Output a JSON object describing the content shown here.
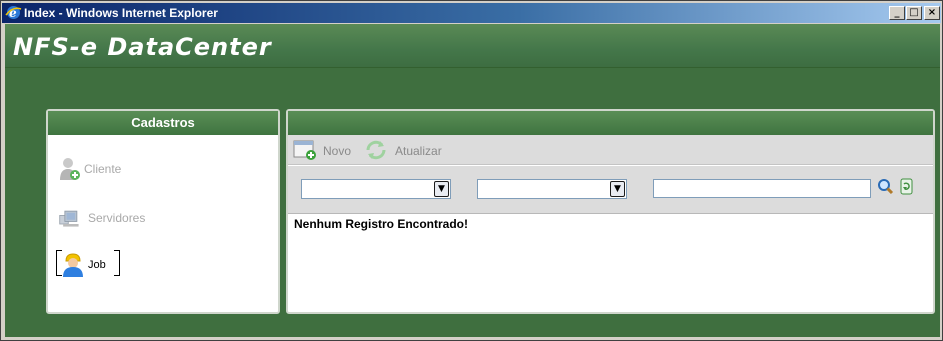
{
  "window": {
    "title": "Index - Windows Internet Explorer",
    "controls": {
      "minimize": "_",
      "maximize": "□",
      "close": "×"
    }
  },
  "app": {
    "brand": "NFS-e DataCenter"
  },
  "left_panel": {
    "header": "Cadastros",
    "items": [
      {
        "label": "Cliente",
        "icon": "user-add-icon",
        "active": false
      },
      {
        "label": "Servidores",
        "icon": "servers-icon",
        "active": false
      },
      {
        "label": "Job",
        "icon": "worker-icon",
        "active": true
      }
    ]
  },
  "right_panel": {
    "header": "",
    "toolbar": {
      "novo_label": "Novo",
      "atualizar_label": "Atualizar"
    },
    "filters": {
      "select1_value": "",
      "select2_value": "",
      "search_value": ""
    },
    "message": "Nenhum Registro Encontrado!"
  },
  "colors": {
    "header_green": "#44774a",
    "background_green": "#3f6f3f",
    "panel_border": "#cfd6cc"
  }
}
